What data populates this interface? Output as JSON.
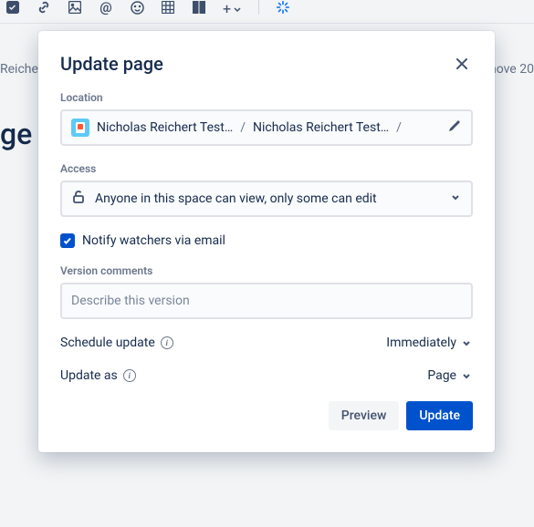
{
  "background": {
    "breadcrumb_left": "Reichert",
    "breadcrumb_right": "nove 20",
    "page_title_fragment": "ge t"
  },
  "modal": {
    "title": "Update page",
    "location": {
      "label": "Location",
      "part1": "Nicholas Reichert Test…",
      "sep1": "/",
      "part2": "Nicholas Reichert Test…",
      "sep2": "/"
    },
    "access": {
      "label": "Access",
      "text": "Anyone in this space can view, only some can edit"
    },
    "notify": {
      "label": "Notify watchers via email",
      "checked": true
    },
    "version": {
      "label": "Version comments",
      "placeholder": "Describe this version",
      "value": ""
    },
    "schedule": {
      "label": "Schedule update",
      "value": "Immediately"
    },
    "update_as": {
      "label": "Update as",
      "value": "Page"
    },
    "buttons": {
      "preview": "Preview",
      "update": "Update"
    }
  }
}
